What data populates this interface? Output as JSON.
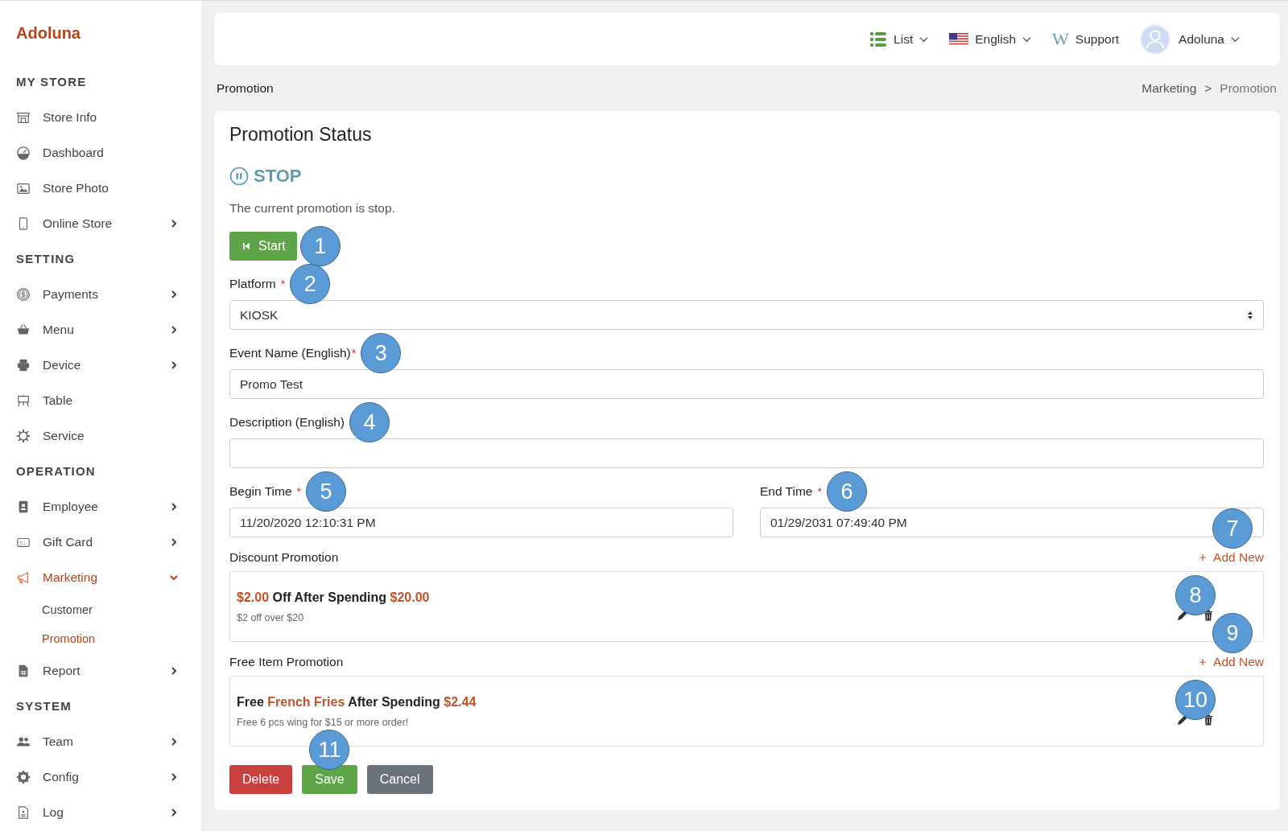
{
  "brand": "Adoluna",
  "sidebar": {
    "sections": [
      {
        "heading": "MY STORE",
        "items": [
          {
            "label": "Store Info",
            "kind": "link",
            "selected": false
          },
          {
            "label": "Dashboard",
            "kind": "link",
            "selected": false
          },
          {
            "label": "Store Photo",
            "kind": "link",
            "selected": false
          },
          {
            "label": "Online Store",
            "kind": "submenu",
            "expanded": false,
            "selected": false
          }
        ]
      },
      {
        "heading": "SETTING",
        "items": [
          {
            "label": "Payments",
            "kind": "submenu",
            "expanded": false,
            "selected": false
          },
          {
            "label": "Menu",
            "kind": "submenu",
            "expanded": false,
            "selected": false
          },
          {
            "label": "Device",
            "kind": "submenu",
            "expanded": false,
            "selected": false
          },
          {
            "label": "Table",
            "kind": "link",
            "selected": false
          },
          {
            "label": "Service",
            "kind": "link",
            "selected": false
          }
        ]
      },
      {
        "heading": "OPERATION",
        "items": [
          {
            "label": "Employee",
            "kind": "submenu",
            "expanded": false,
            "selected": false
          },
          {
            "label": "Gift Card",
            "kind": "submenu",
            "expanded": false,
            "selected": false
          },
          {
            "label": "Marketing",
            "kind": "submenu",
            "expanded": true,
            "selected": true,
            "children": [
              {
                "label": "Customer",
                "selected": false
              },
              {
                "label": "Promotion",
                "selected": true
              }
            ]
          },
          {
            "label": "Report",
            "kind": "submenu",
            "expanded": false,
            "selected": false
          }
        ]
      },
      {
        "heading": "SYSTEM",
        "items": [
          {
            "label": "Team",
            "kind": "submenu",
            "expanded": false,
            "selected": false
          },
          {
            "label": "Config",
            "kind": "submenu",
            "expanded": false,
            "selected": false
          },
          {
            "label": "Log",
            "kind": "submenu",
            "expanded": false,
            "selected": false
          }
        ]
      }
    ]
  },
  "topbar": {
    "items": [
      {
        "kind": "list",
        "label": "List"
      },
      {
        "kind": "language",
        "label": "English"
      },
      {
        "kind": "support",
        "logo": "W",
        "label": "Support"
      },
      {
        "kind": "user",
        "label": "Adoluna"
      }
    ]
  },
  "page_title": "Promotion",
  "breadcrumb": {
    "items": [
      "Marketing",
      "Promotion"
    ],
    "separator": ">"
  },
  "card": {
    "title": "Promotion Status",
    "status": {
      "kind": "stopped",
      "label": "STOP"
    },
    "message": "The current promotion is stop.",
    "start_button": {
      "label": "Start",
      "callout": "1"
    },
    "fields": [
      {
        "kind": "select",
        "label": "Platform",
        "marker": "*",
        "value": "KIOSK",
        "callout": "2"
      },
      {
        "kind": "text",
        "label": "Event Name (English)",
        "marker": "*",
        "value": "Promo Test",
        "callout": "3"
      },
      {
        "kind": "text",
        "label": "Description (English)",
        "callout": "4"
      }
    ],
    "times": [
      {
        "label": "Begin Time",
        "marker": "*",
        "value": "11/20/2020 12:10:31 PM",
        "callout": "5"
      },
      {
        "label": "End Time",
        "marker": "*",
        "value": "01/29/2031 07:49:40 PM",
        "callout": "6"
      }
    ],
    "promotions": [
      {
        "heading": "Discount Promotion",
        "add_label": "Add New",
        "add_callout": "7",
        "items": [
          {
            "title": [
              {
                "text": "$2.00",
                "highlight": true
              },
              {
                "text": " Off After Spending ",
                "highlight": false
              },
              {
                "text": "$20.00",
                "highlight": true
              }
            ],
            "note": "$2 off over $20",
            "actions_callout": "8"
          }
        ]
      },
      {
        "heading": "Free Item Promotion",
        "add_label": "Add New",
        "add_callout": "9",
        "items": [
          {
            "title": [
              {
                "text": "Free ",
                "highlight": false
              },
              {
                "text": "French Fries",
                "highlight": true
              },
              {
                "text": " After Spending ",
                "highlight": false
              },
              {
                "text": "$2.44",
                "highlight": true
              }
            ],
            "note": "Free 6 pcs wing for $15 or more order!",
            "actions_callout": "10"
          }
        ]
      }
    ],
    "buttons": [
      {
        "kind": "danger",
        "label": "Delete"
      },
      {
        "kind": "success",
        "label": "Save",
        "callout": "11"
      },
      {
        "kind": "secondary",
        "label": "Cancel"
      }
    ]
  }
}
